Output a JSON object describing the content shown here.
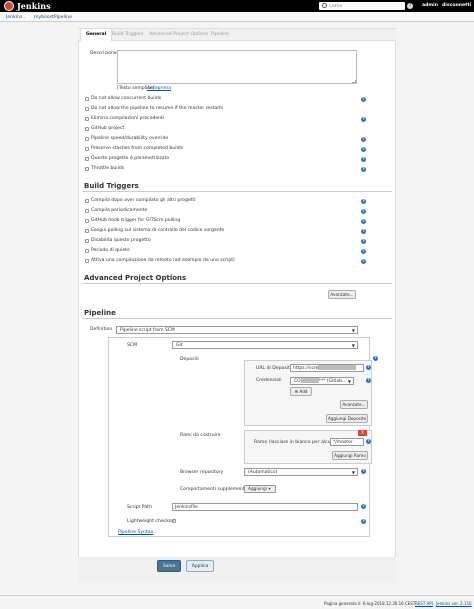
{
  "header": {
    "brand": "Jenkins",
    "search_placeholder": "Cerca",
    "help": "?",
    "user": "admin",
    "logout": "disconnetti"
  },
  "breadcrumbs": [
    "Jenkins",
    "myboostPipeline"
  ],
  "tabs": [
    "General",
    "Build Triggers",
    "Advanced Project Options",
    "Pipeline"
  ],
  "general": {
    "description_label": "Descrizione",
    "preview_text": "[Testo semplice]",
    "preview_link": "Anteprima",
    "options": [
      "Do not allow concurrent builds",
      "Do not allow the pipeline to resume if the master restarts",
      "Elimina compilazioni precedenti",
      "GitHub project",
      "Pipeline speed/durability override",
      "Preserve stashes from completed builds",
      "Questo progetto è parametrizzato",
      "Throttle builds"
    ]
  },
  "build_triggers": {
    "title": "Build Triggers",
    "options": [
      "Compila dopo aver compilato gli altri progetti",
      "Compila periodicamente",
      "GitHub hook trigger for GITScm polling",
      "Esegui polling sul sistema di controllo del codice sorgente",
      "Disabilita questo progetto",
      "Periodo di quiete",
      "Attiva una compilazione da remoto (ad esempio da uno script)"
    ]
  },
  "advanced": {
    "title": "Advanced Project Options",
    "button": "Avanzate..."
  },
  "pipeline": {
    "title": "Pipeline",
    "definition_label": "Definition",
    "definition_value": "Pipeline script from SCM",
    "scm_label": "SCM",
    "scm_value": "Git",
    "repos_label": "Depositi",
    "repo_url_label": "URL di Deposito",
    "repo_url_value": "https://scm",
    "credentials_label": "Credenziali",
    "credentials_prefix": "CO",
    "credentials_suffix": "*** (Gitlab...",
    "add_label": "Add",
    "advanced_button": "Avanzate...",
    "add_repo_button": "Aggiungi Deposito",
    "branches_label": "Rami da costruire",
    "branch_spec_label": "Ramo (lasciare in bianco per alcuno)",
    "branch_spec_value": "*/master",
    "add_branch_button": "Aggiungi Ramo",
    "remove_button": "X",
    "browser_label": "Browser repository",
    "browser_value": "(Automatico)",
    "extra_label": "Comportamenti supplementari",
    "extra_button": "Aggiungi",
    "script_path_label": "Script Path",
    "script_path_value": "Jenkinsfile",
    "lightweight_label": "Lightweight checkout",
    "syntax_link": "Pipeline Syntax"
  },
  "actions": {
    "save": "Salva",
    "apply": "Applica"
  },
  "footer": {
    "generated": "Pagina generata il: 6-lug-2018 12.30.16 CEST",
    "api": "REST API",
    "version": "Jenkins ver. 2.150"
  },
  "colors": {
    "header_bg": "#000000",
    "link": "#204a87",
    "help_icon": "#2a72c2",
    "save_button": "#4b758b",
    "apply_button": "#e4ecf5",
    "remove_button": "#d24939"
  }
}
